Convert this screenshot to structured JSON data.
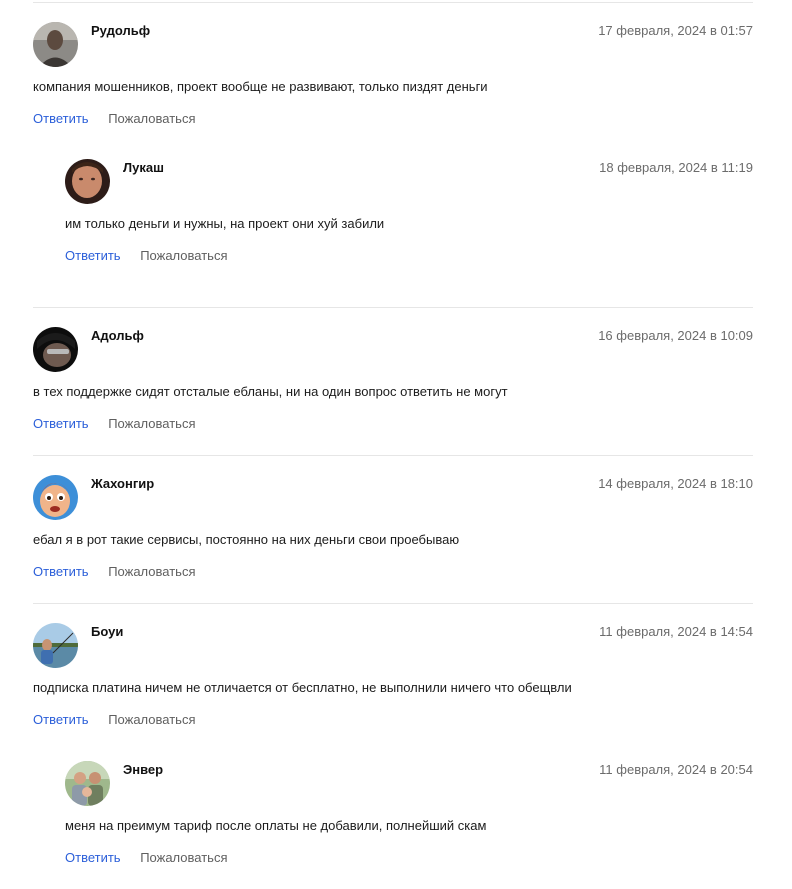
{
  "actions": {
    "reply_label": "Ответить",
    "report_label": "Пожаловаться"
  },
  "comments": [
    {
      "author": "Рудольф",
      "date": "17 февраля, 2024 в 01:57",
      "text": "компания мошенников, проект вообще не развивают, только пиздят деньги",
      "avatar": "avatar-rudolf"
    },
    {
      "author": "Лукаш",
      "date": "18 февраля, 2024 в 11:19",
      "text": "им только деньги и нужны, на проект они хуй забили",
      "avatar": "avatar-lukash"
    },
    {
      "author": "Адольф",
      "date": "16 февраля, 2024 в 10:09",
      "text": "в тех поддержке сидят отсталые ебланы, ни на один вопрос ответить не могут",
      "avatar": "avatar-adolf"
    },
    {
      "author": "Жахонгир",
      "date": "14 февраля, 2024 в 18:10",
      "text": "ебал я в рот такие сервисы, постоянно на них деньги свои проебываю",
      "avatar": "avatar-zhakhongir"
    },
    {
      "author": "Боуи",
      "date": "11 февраля, 2024 в 14:54",
      "text": "подписка платина ничем не отличается от бесплатно, не выполнили ничего что обещвли",
      "avatar": "avatar-boui"
    },
    {
      "author": "Энвер",
      "date": "11 февраля, 2024 в 20:54",
      "text": "меня на преимум тариф после оплаты не добавили, полнейший скам",
      "avatar": "avatar-enver"
    }
  ]
}
